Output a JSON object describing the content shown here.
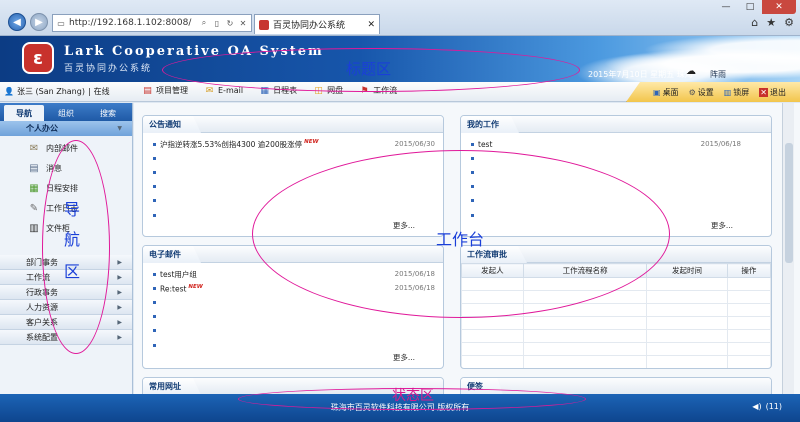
{
  "browser": {
    "url": "http://192.168.1.102:8008/",
    "tab_title": "百灵协同办公系统",
    "win_min": "—",
    "win_max": "□",
    "win_close": "✕",
    "home_glyph": "⌂",
    "star_glyph": "★",
    "gear_glyph": "⚙"
  },
  "header": {
    "logo_glyph": "ε",
    "brand_en": "Lark Cooperative OA System",
    "brand_cn": "百灵协同办公系统",
    "date": "2015年7月10日 星期五 珠海",
    "weather": "阵雨",
    "weather_icon": "cloud-rain-icon"
  },
  "user": {
    "name": "张三 (San Zhang)",
    "separator": "|",
    "status": "在线"
  },
  "quick_links": [
    {
      "label": "项目管理",
      "icon": "▤"
    },
    {
      "label": "E-mail",
      "icon": "✉"
    },
    {
      "label": "日程表",
      "icon": "▦"
    },
    {
      "label": "网盘",
      "icon": "◫"
    },
    {
      "label": "工作流",
      "icon": "⚑"
    }
  ],
  "right_tools": [
    {
      "label": "桌面",
      "icon": "▣"
    },
    {
      "label": "设置",
      "icon": "⚙"
    },
    {
      "label": "锁屏",
      "icon": "▥"
    },
    {
      "label": "退出",
      "icon": "✕"
    }
  ],
  "sidebar": {
    "tabs": [
      "导航",
      "组织",
      "搜索"
    ],
    "open_category": "个人办公",
    "open_items": [
      {
        "label": "内部邮件",
        "icon": "✉"
      },
      {
        "label": "消息",
        "icon": "▤"
      },
      {
        "label": "日程安排",
        "icon": "▦"
      },
      {
        "label": "工作日志",
        "icon": "✎"
      },
      {
        "label": "文件柜",
        "icon": "▥"
      }
    ],
    "closed_categories": [
      "部门事务",
      "工作流",
      "行政事务",
      "人力资源",
      "客户关系",
      "系统配置"
    ]
  },
  "panels": {
    "notices": {
      "title": "公告通知",
      "items": [
        {
          "text": "沪指逆转涨5.53%创指4300 逾200股涨停",
          "date": "2015/06/30",
          "new": true
        }
      ],
      "more": "更多..."
    },
    "my_work": {
      "title": "我的工作",
      "items": [
        {
          "text": "test",
          "date": "2015/06/18",
          "new": false
        }
      ],
      "more": "更多..."
    },
    "email": {
      "title": "电子邮件",
      "items": [
        {
          "text": "test用户组",
          "date": "2015/06/18",
          "new": false
        },
        {
          "text": "Re:test",
          "date": "2015/06/18",
          "new": true
        }
      ],
      "more": "更多..."
    },
    "workflow": {
      "title": "工作流审批",
      "columns": [
        "发起人",
        "工作流程名称",
        "发起时间",
        "操作"
      ]
    },
    "links": {
      "title": "常用网址"
    },
    "notes": {
      "title": "便签"
    },
    "new_badge": "NEW"
  },
  "status": {
    "copyright": "珠海市百灵软件科技有限公司 版权所有",
    "volume_icon": "speaker-icon",
    "volume_glyph": "◀)",
    "count": "(11)"
  },
  "annotations": {
    "header_region": "标题区",
    "nav_region": [
      "导",
      "航",
      "区"
    ],
    "workspace_region": "工作台",
    "status_region": "状态区"
  }
}
